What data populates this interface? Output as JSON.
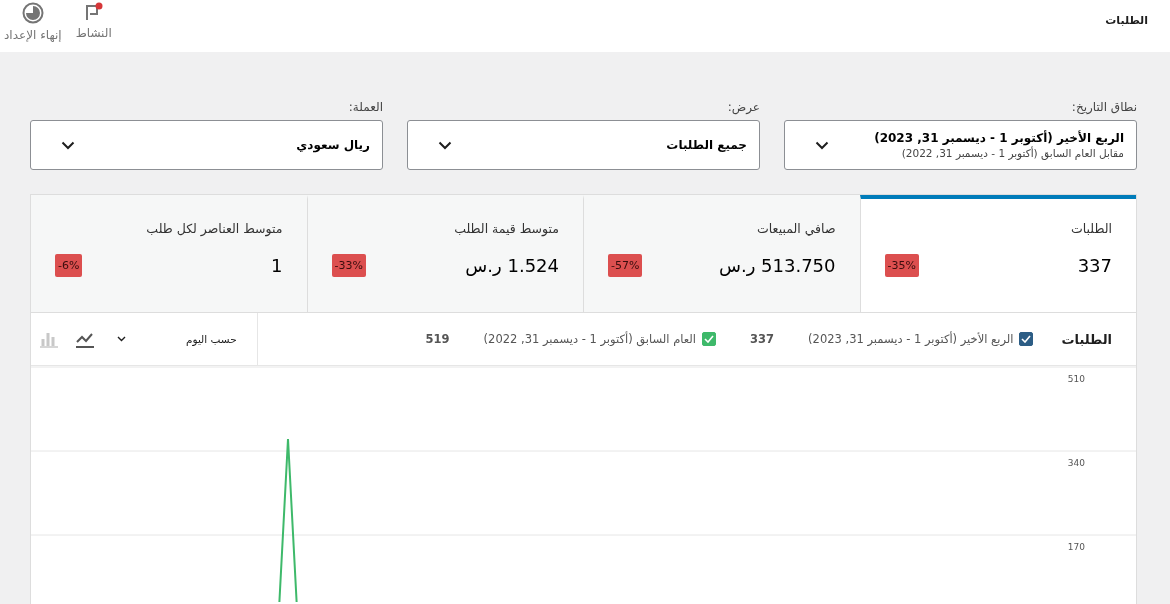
{
  "header": {
    "title": "الطلبات",
    "actions": [
      {
        "label": "النشاط"
      },
      {
        "label": "إنهاء الإعداد"
      }
    ]
  },
  "filters": [
    {
      "label": "نطاق التاريخ:",
      "value": "الربع الأخير (أكتوبر 1 - ديسمبر 31, 2023)",
      "secondary": "مقابل العام السابق (أكتوبر 1 - ديسمبر 31, 2022)"
    },
    {
      "label": "عرض:",
      "value": "جميع الطلبات"
    },
    {
      "label": "العملة:",
      "value": "ريال سعودي"
    }
  ],
  "summary": [
    {
      "label": "الطلبات",
      "value": "337",
      "delta": "-35%",
      "selected": true
    },
    {
      "label": "صافي المبيعات",
      "value": "513.750 ر.س",
      "delta": "-57%",
      "selected": false
    },
    {
      "label": "متوسط قيمة الطلب",
      "value": "1.524 ر.س",
      "delta": "-33%",
      "selected": false
    },
    {
      "label": "متوسط العناصر لكل طلب",
      "value": "1",
      "delta": "-6%",
      "selected": false
    }
  ],
  "chart": {
    "title": "الطلبات",
    "legend": [
      {
        "label": "الربع الأخير (أكتوبر 1 - ديسمبر 31, 2023)",
        "total": "337",
        "checked": true,
        "color": "#2c5d85"
      },
      {
        "label": "العام السابق (أكتوبر 1 - ديسمبر 31, 2022)",
        "total": "519",
        "checked": true,
        "color": "#3eb96a"
      }
    ],
    "interval": "حسب اليوم",
    "types": [
      {
        "kind": "line",
        "selected": true
      },
      {
        "kind": "bar",
        "selected": false
      }
    ],
    "y_ticks": [
      "510",
      "340",
      "170"
    ]
  }
}
